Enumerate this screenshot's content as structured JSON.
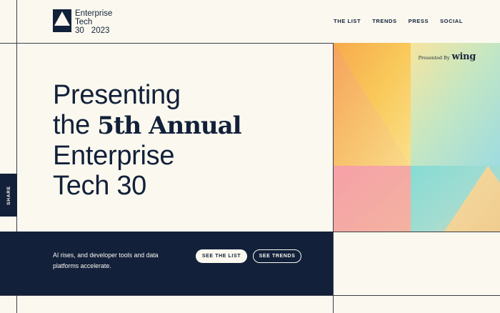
{
  "header": {
    "logo": {
      "line1": "Enterprise",
      "line2": "Tech",
      "line3_a": "30",
      "line3_b": "2023"
    },
    "nav": [
      {
        "label": "THE LIST"
      },
      {
        "label": "TRENDS"
      },
      {
        "label": "PRESS"
      },
      {
        "label": "SOCIAL"
      }
    ]
  },
  "hero": {
    "line1": "Presenting",
    "line2_a": "the ",
    "line2_b": "5th Annual",
    "line3": "Enterprise",
    "line4": "Tech 30"
  },
  "sponsor": {
    "prefix": "Presented By",
    "brand": "wing"
  },
  "share": {
    "label": "SHARE"
  },
  "band": {
    "description": "AI rises, and developer tools and data platforms accelerate.",
    "primary_button": "SEE THE LIST",
    "secondary_button": "SEE TRENDS"
  },
  "colors": {
    "navy": "#12203a",
    "cream": "#fbf9ef"
  }
}
